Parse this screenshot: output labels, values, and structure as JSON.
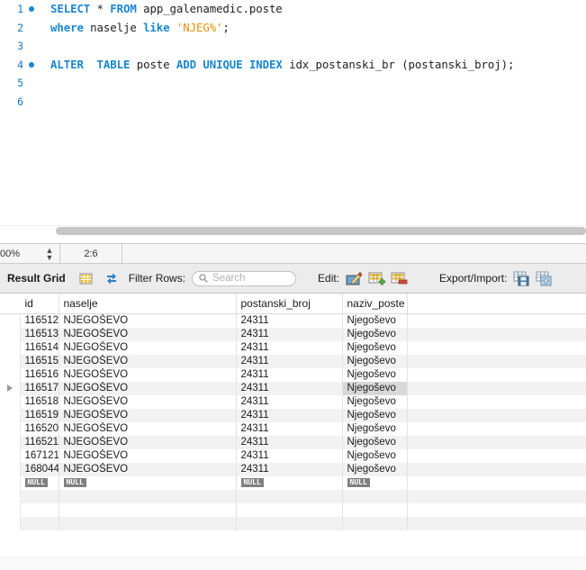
{
  "editor": {
    "lines": [
      {
        "number": "1",
        "has_breakpoint": true,
        "tokens": [
          {
            "t": "SELECT",
            "c": "kw"
          },
          {
            "t": " ",
            "c": "op"
          },
          {
            "t": "*",
            "c": "op"
          },
          {
            "t": " ",
            "c": "op"
          },
          {
            "t": "FROM",
            "c": "kw"
          },
          {
            "t": " app_galenamedic.poste",
            "c": "op"
          }
        ],
        "plain": "SELECT * FROM app_galenamedic.poste"
      },
      {
        "number": "2",
        "has_breakpoint": false,
        "tokens": [
          {
            "t": "where",
            "c": "kw"
          },
          {
            "t": " naselje ",
            "c": "op"
          },
          {
            "t": "like",
            "c": "kw"
          },
          {
            "t": " ",
            "c": "op"
          },
          {
            "t": "'NJEG%'",
            "c": "str"
          },
          {
            "t": ";",
            "c": "op"
          }
        ],
        "plain": "where naselje like 'NJEG%';"
      },
      {
        "number": "3",
        "has_breakpoint": false,
        "tokens": [],
        "plain": ""
      },
      {
        "number": "4",
        "has_breakpoint": true,
        "tokens": [
          {
            "t": "ALTER",
            "c": "kw"
          },
          {
            "t": "  ",
            "c": "op"
          },
          {
            "t": "TABLE",
            "c": "kw"
          },
          {
            "t": " poste ",
            "c": "op"
          },
          {
            "t": "ADD",
            "c": "kw"
          },
          {
            "t": " ",
            "c": "op"
          },
          {
            "t": "UNIQUE",
            "c": "kw"
          },
          {
            "t": " ",
            "c": "op"
          },
          {
            "t": "INDEX",
            "c": "kw"
          },
          {
            "t": " idx_postanski_br (postanski_broj);",
            "c": "op"
          }
        ],
        "plain": "ALTER  TABLE poste ADD UNIQUE INDEX idx_postanski_br (postanski_broj);"
      },
      {
        "number": "5",
        "has_breakpoint": false,
        "tokens": [],
        "plain": ""
      },
      {
        "number": "6",
        "has_breakpoint": false,
        "tokens": [],
        "plain": ""
      }
    ]
  },
  "statusbar": {
    "zoom": "00%",
    "cursor_position": "2:6"
  },
  "result_toolbar": {
    "title": "Result Grid",
    "grid_view_icon": "grid-view-icon",
    "refresh_icon": "refresh-icon",
    "filter_label": "Filter Rows:",
    "search_value": "",
    "search_placeholder": "Search",
    "search_icon": "search-icon",
    "edit_label": "Edit:",
    "edit_buttons": [
      {
        "name": "edit-row-button",
        "icon": "pencil-grid-icon"
      },
      {
        "name": "insert-row-button",
        "icon": "grid-plus-icon"
      },
      {
        "name": "delete-row-button",
        "icon": "grid-minus-icon"
      }
    ],
    "export_label": "Export/Import:",
    "export_buttons": [
      {
        "name": "export-recordset-button",
        "icon": "grid-save-icon"
      },
      {
        "name": "import-recordset-button",
        "icon": "grid-import-icon"
      }
    ]
  },
  "grid": {
    "columns": [
      "id",
      "naselje",
      "postanski_broj",
      "naziv_poste",
      ""
    ],
    "selected_row_index": 5,
    "selected_column_index": 3,
    "rows": [
      {
        "id": "116512",
        "naselje": "NJEGOŠEVO",
        "postanski_broj": "24311",
        "naziv_poste": "Njegoševo"
      },
      {
        "id": "116513",
        "naselje": "NJEGOŠEVO",
        "postanski_broj": "24311",
        "naziv_poste": "Njegoševo"
      },
      {
        "id": "116514",
        "naselje": "NJEGOŠEVO",
        "postanski_broj": "24311",
        "naziv_poste": "Njegoševo"
      },
      {
        "id": "116515",
        "naselje": "NJEGOŠEVO",
        "postanski_broj": "24311",
        "naziv_poste": "Njegoševo"
      },
      {
        "id": "116516",
        "naselje": "NJEGOŠEVO",
        "postanski_broj": "24311",
        "naziv_poste": "Njegoševo"
      },
      {
        "id": "116517",
        "naselje": "NJEGOŠEVO",
        "postanski_broj": "24311",
        "naziv_poste": "Njegoševo"
      },
      {
        "id": "116518",
        "naselje": "NJEGOŠEVO",
        "postanski_broj": "24311",
        "naziv_poste": "Njegoševo"
      },
      {
        "id": "116519",
        "naselje": "NJEGOŠEVO",
        "postanski_broj": "24311",
        "naziv_poste": "Njegoševo"
      },
      {
        "id": "116520",
        "naselje": "NJEGOŠEVO",
        "postanski_broj": "24311",
        "naziv_poste": "Njegoševo"
      },
      {
        "id": "116521",
        "naselje": "NJEGOŠEVO",
        "postanski_broj": "24311",
        "naziv_poste": "Njegoševo"
      },
      {
        "id": "167121",
        "naselje": "NJEGOŠEVO",
        "postanski_broj": "24311",
        "naziv_poste": "Njegoševo"
      },
      {
        "id": "168044",
        "naselje": "NJEGOŠEVO",
        "postanski_broj": "24311",
        "naziv_poste": "Njegoševo"
      }
    ],
    "new_row": {
      "id": "NULL",
      "naselje": "NULL",
      "postanski_broj": "NULL",
      "naziv_poste": "NULL"
    },
    "empty_row_count": 3
  },
  "colors": {
    "keyword": "#1a86d0",
    "string": "#e8900c",
    "line_number": "#1878b4",
    "null_badge": "#808080",
    "selection": "#d8d8d8",
    "toolbar_bg": "#ececec",
    "alt_row": "#f2f2f2"
  }
}
